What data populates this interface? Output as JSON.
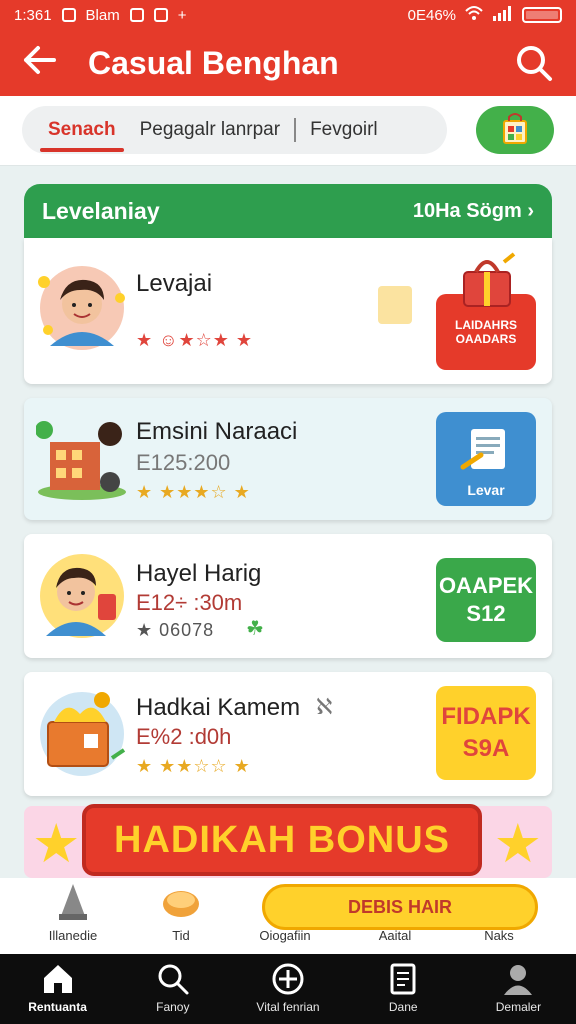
{
  "status_bar": {
    "time": "1:361",
    "app_label": "Blam",
    "battery_text": "0Е46%"
  },
  "app_bar": {
    "title": "Casual Benghan"
  },
  "tabs": [
    {
      "label": "Senach",
      "active": true
    },
    {
      "label": "Pegagalr lanrpar",
      "active": false
    },
    {
      "label": "Fevgoirl",
      "active": false
    }
  ],
  "section": {
    "title": "Levelaniay",
    "link": "10Ha Sögm ›"
  },
  "items": [
    {
      "name": "Levajai",
      "sub": "",
      "stars_text": "★ ☺★☆★ ★",
      "badge_text": "LAIDAHRS OAADARS",
      "badge_color": "#e53a2a",
      "thumb": "man-avatar-icon"
    },
    {
      "name": "Emsini Naraaci",
      "sub": "E125:200",
      "stars_text": "★ ★★★☆ ★",
      "badge_text": "Levar",
      "badge_color": "#3f8fd0",
      "thumb": "house-icon"
    },
    {
      "name": "Hayel Harig",
      "sub": "E12÷ :30m",
      "stars_text": "★ 06078",
      "badge_text": "OAAPEK S12",
      "badge_color": "#3aa84a",
      "thumb": "man-avatar-icon"
    },
    {
      "name": "Hadkai Kamem",
      "sub": "E%2 :d0h",
      "stars_text": "★ ★★☆☆ ★",
      "badge_text": "FIDAPK S9A",
      "badge_color": "#ffd12b",
      "thumb": "gift-box-icon"
    }
  ],
  "bonus": {
    "label": "HADIKAH BONUS"
  },
  "shortcuts": [
    {
      "label": "Illanedie",
      "icon": "cone-icon"
    },
    {
      "label": "Tid",
      "icon": "bread-icon"
    },
    {
      "label": "Oiogafiin",
      "icon": "fruit-icon"
    },
    {
      "label": "Aaital",
      "icon": "none"
    },
    {
      "label": "Naks",
      "icon": "jar-icon"
    }
  ],
  "deals_pill": "DEBIS HAIR",
  "bottom_nav": [
    {
      "label": "Rentuanta",
      "icon": "home-icon",
      "active": true
    },
    {
      "label": "Fanoy",
      "icon": "search-icon",
      "active": false
    },
    {
      "label": "Vital fenrian",
      "icon": "add-circle-icon",
      "active": false
    },
    {
      "label": "Dane",
      "icon": "document-icon",
      "active": false
    },
    {
      "label": "Demaler",
      "icon": "person-icon",
      "active": false
    }
  ],
  "colors": {
    "primary_red": "#e53a2a",
    "green": "#2e9e4e",
    "yellow": "#ffd12b"
  }
}
